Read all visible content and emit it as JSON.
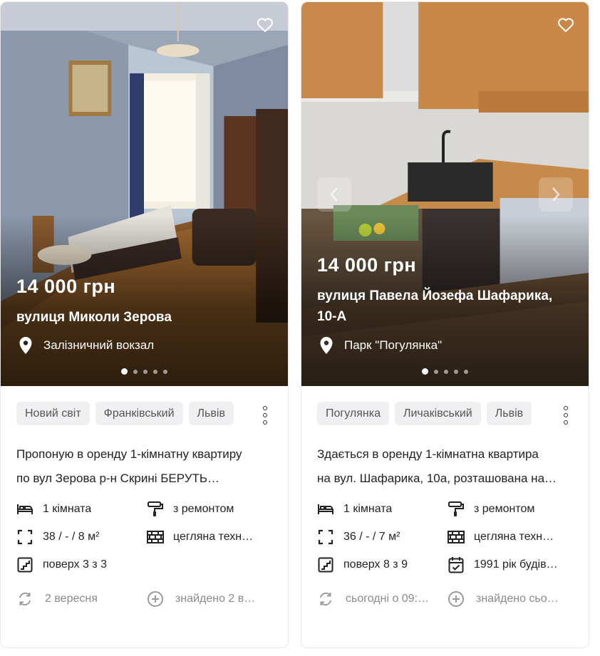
{
  "listings": [
    {
      "price": "14 000 грн",
      "street": "вулиця Миколи Зерова",
      "location": "Залізничний вокзал",
      "tags": [
        "Новий світ",
        "Франківський",
        "Львів"
      ],
      "description_line1": "Пропоную в оренду 1-кімнатну квартиру",
      "description_line2": "по вул Зерова р-н Скрині БЕРУТЬ…",
      "features": {
        "rooms": "1 кімната",
        "repair": "з ремонтом",
        "area": "38 / - / 8 м²",
        "building": "цегляна техн…",
        "floor": "поверх 3 з 3"
      },
      "date": "2 вересня",
      "found": "знайдено 2 в…"
    },
    {
      "price": "14 000 грн",
      "street": "вулиця Павела Йозефа Шафарика, 10-А",
      "location": "Парк \"Погулянка\"",
      "tags": [
        "Погулянка",
        "Личаківський",
        "Львів"
      ],
      "description_line1": "Здається в оренду 1-кімнатна квартира",
      "description_line2": "на вул. Шафарика, 10а, розташована на…",
      "features": {
        "rooms": "1 кімната",
        "repair": "з ремонтом",
        "area": "36 / - / 7 м²",
        "building": "цегляна техн…",
        "floor": "поверх 8 з 9",
        "year": "1991 рік будів…"
      },
      "date": "сьогодні о 09:…",
      "found": "знайдено сьо…"
    }
  ],
  "icons": {
    "favorite": "heart-icon",
    "location": "map-pin-icon",
    "more": "kebab-menu-icon",
    "rooms": "bed-icon",
    "repair": "paint-roller-icon",
    "area": "area-icon",
    "building": "brick-wall-icon",
    "floor": "stairs-icon",
    "year": "calendar-icon",
    "date": "refresh-icon",
    "found": "plus-circle-icon"
  },
  "colors": {
    "tag_bg": "#f0f0f2",
    "meta_text": "#8a8a8a"
  }
}
